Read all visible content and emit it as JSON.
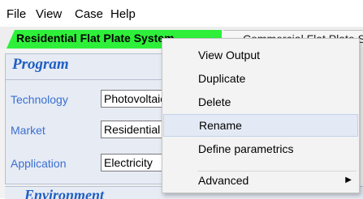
{
  "menubar": {
    "items": [
      "File",
      "View",
      "Case",
      "Help"
    ]
  },
  "tabs": [
    {
      "label": "Residential Flat Plate System",
      "active": true,
      "color": "#2ef03a"
    },
    {
      "label": "Commercial Flat Plate System",
      "active": false
    }
  ],
  "program": {
    "title": "Program",
    "fields": [
      {
        "label": "Technology",
        "value": "Photovoltaic"
      },
      {
        "label": "Market",
        "value": "Residential"
      },
      {
        "label": "Application",
        "value": "Electricity"
      }
    ]
  },
  "environment": {
    "title": "Environment"
  },
  "context_menu": {
    "items": [
      {
        "label": "View Output"
      },
      {
        "label": "Duplicate"
      },
      {
        "label": "Delete"
      },
      {
        "label": "Rename",
        "highlighted": true
      },
      {
        "label": "Define parametrics"
      },
      {
        "label": "Advanced",
        "submenu": true,
        "arrow_icon": "submenu-arrow-icon"
      }
    ]
  },
  "colors": {
    "accent": "#1f5fc2",
    "active_tab": "#2ef03a",
    "highlight": "#e3eaf5"
  }
}
